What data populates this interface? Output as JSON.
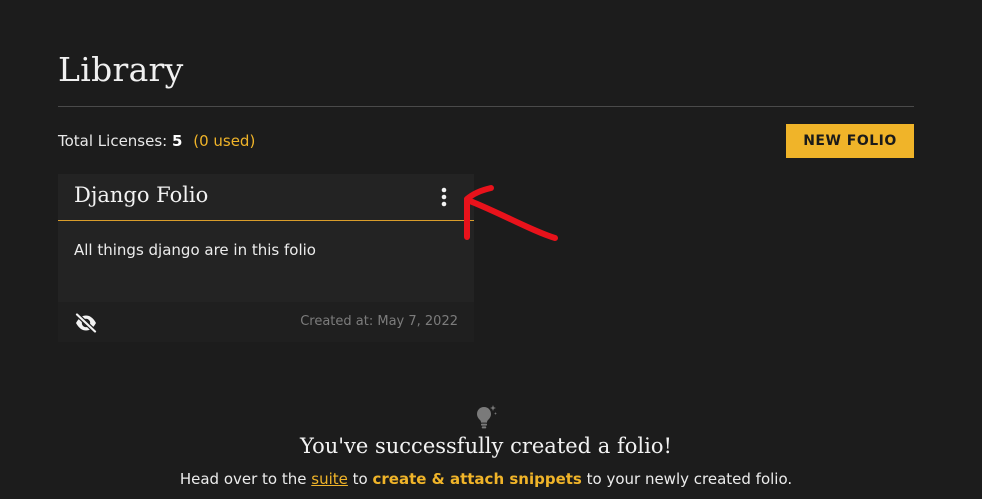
{
  "page": {
    "title": "Library"
  },
  "licenses": {
    "label": "Total Licenses:",
    "count": "5",
    "used": "(0 used)"
  },
  "toolbar": {
    "new_folio_label": "NEW FOLIO"
  },
  "folio_card": {
    "title": "Django Folio",
    "description": "All things django are in this folio",
    "created": "Created at: May 7, 2022",
    "menu_icon": "more-vertical-icon",
    "visibility_icon": "eye-off-icon"
  },
  "success": {
    "icon": "lightbulb-icon",
    "title": "You've successfully created a folio!",
    "text_before": "Head over to the",
    "link": "suite",
    "text_middle": "to",
    "accent": "create & attach snippets",
    "text_after": "to your newly created folio."
  },
  "annotation": {
    "color": "#e8121b",
    "icon": "hand-drawn-arrow"
  },
  "colors": {
    "background": "#1c1c1c",
    "card": "#232323",
    "accent": "#f0b429"
  }
}
